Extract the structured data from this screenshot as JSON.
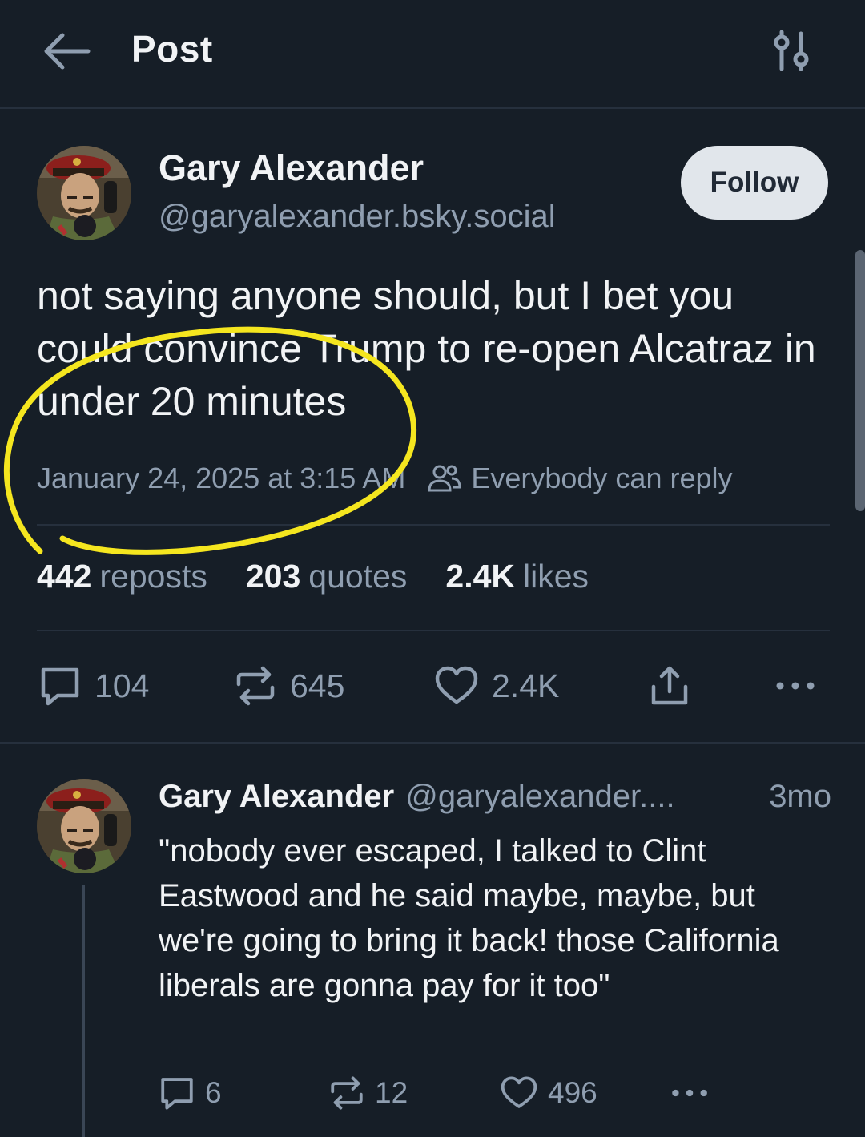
{
  "header": {
    "title": "Post",
    "back_icon": "arrow-left-icon",
    "settings_icon": "sliders-icon"
  },
  "post": {
    "author_name": "Gary Alexander",
    "author_handle": "@garyalexander.bsky.social",
    "follow_label": "Follow",
    "text": "not saying anyone should, but I bet you could convince Trump to re-open Alcatraz in under 20 minutes",
    "date": "January 24, 2025 at 3:15 AM",
    "reply_permission": "Everybody can reply",
    "stats": {
      "reposts_count": "442",
      "reposts_label": "reposts",
      "quotes_count": "203",
      "quotes_label": "quotes",
      "likes_count": "2.4K",
      "likes_label": "likes"
    },
    "actions": {
      "replies": "104",
      "reposts": "645",
      "likes": "2.4K"
    }
  },
  "reply": {
    "author_name": "Gary Alexander",
    "author_handle": "@garyalexander....",
    "time": "3mo",
    "text": "\"nobody ever escaped, I talked to Clint Eastwood and he said maybe, maybe, but we're going to bring it back! those California liberals are gonna pay for it too\"",
    "actions": {
      "replies": "6",
      "reposts": "12",
      "likes": "496"
    }
  },
  "colors": {
    "background": "#161e27",
    "text_primary": "#f1f3f5",
    "text_secondary": "#8f9eb0",
    "divider": "#26303d",
    "follow_bg": "#e1e6eb",
    "annotation": "#f5e61f"
  }
}
